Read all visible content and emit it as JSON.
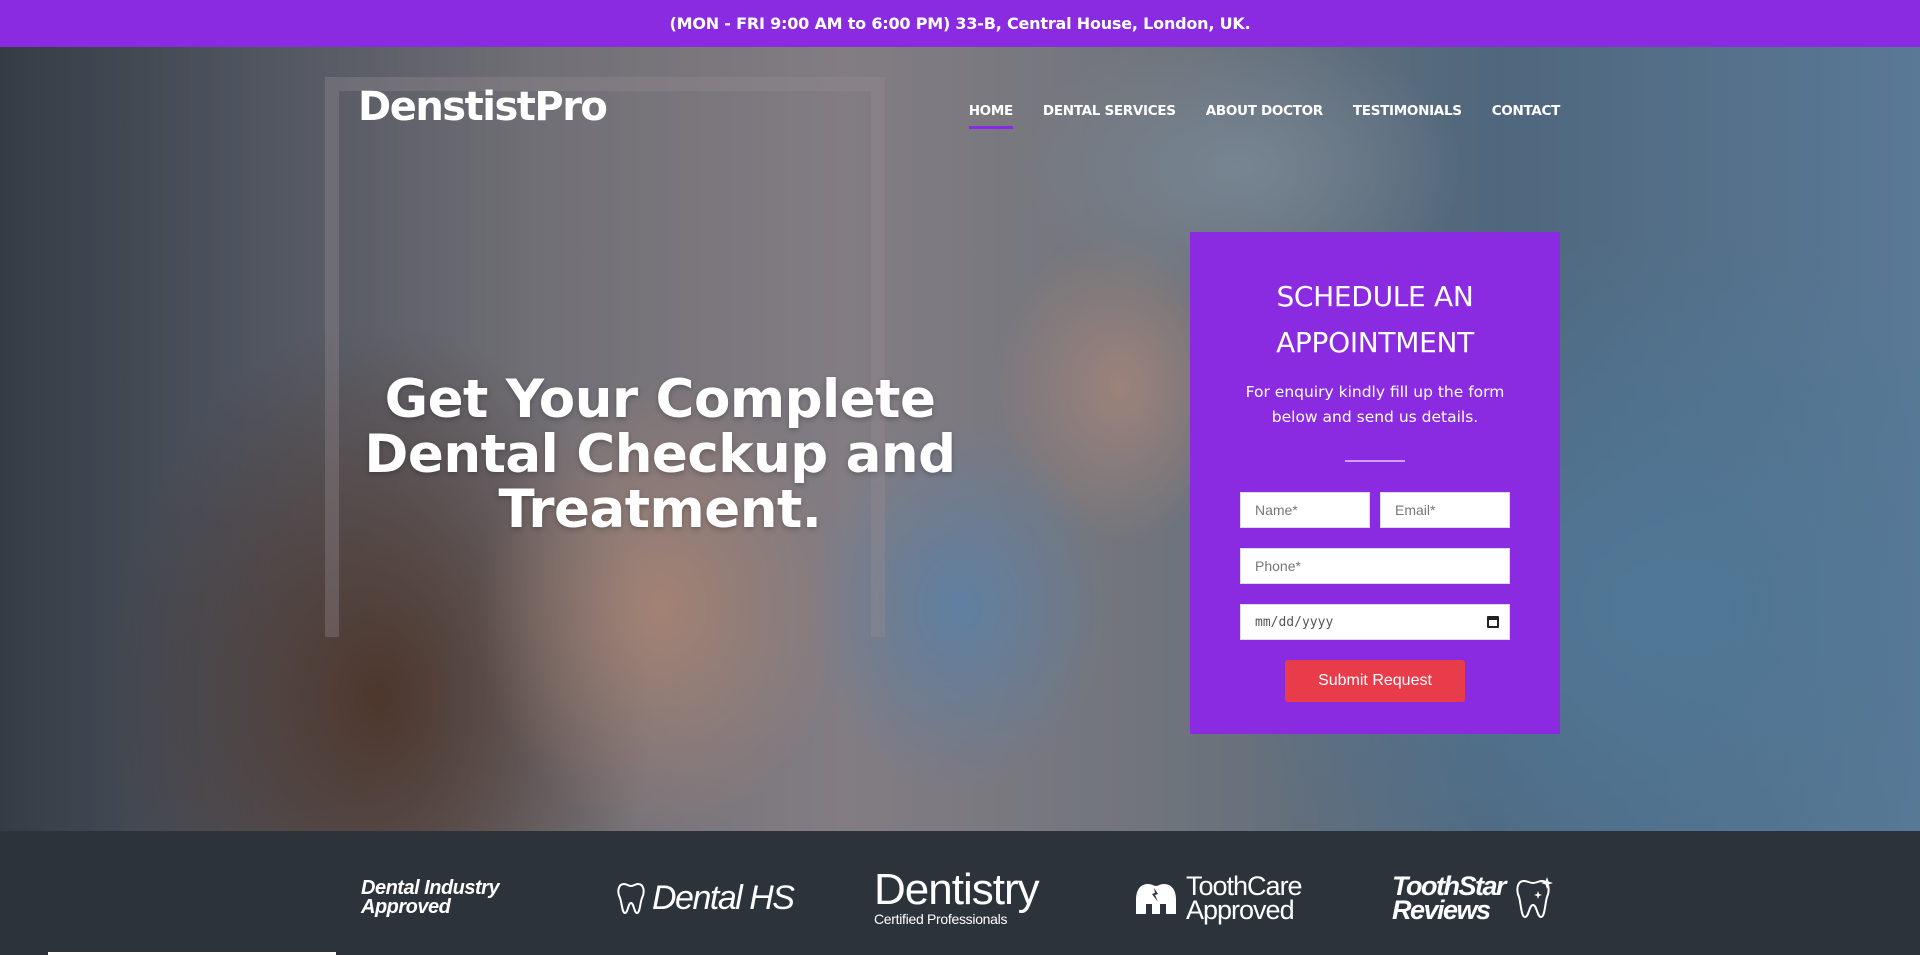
{
  "topbar": {
    "text": "(MON - FRI 9:00 AM to 6:00 PM) 33-B, Central House, London, UK."
  },
  "brand": {
    "name": "DenstistPro"
  },
  "nav": {
    "items": [
      {
        "label": "HOME",
        "active": true
      },
      {
        "label": "DENTAL SERVICES"
      },
      {
        "label": "ABOUT DOCTOR"
      },
      {
        "label": "TESTIMONIALS"
      },
      {
        "label": "CONTACT"
      }
    ]
  },
  "hero": {
    "headline": "Get Your Complete Dental Checkup and Treatment."
  },
  "appointment": {
    "title": "SCHEDULE AN APPOINTMENT",
    "subtitle": "For enquiry kindly fill up the form below and send us details.",
    "name_placeholder": "Name*",
    "email_placeholder": "Email*",
    "phone_placeholder": "Phone*",
    "date_placeholder": "mm/dd/yyyy",
    "submit_label": "Submit Request"
  },
  "partner_logos": {
    "dental_industry_line1": "Dental Industry",
    "dental_industry_line2": "Approved",
    "dental_hs": "Dental HS",
    "dentistry": "Dentistry",
    "dentistry_sub": "Certified Professionals",
    "toothcare_line1": "ToothCare",
    "toothcare_line2": "Approved",
    "toothstar_line1": "ToothStar",
    "toothstar_line2": "Reviews"
  },
  "colors": {
    "brand_purple": "#8a2be2",
    "submit_red": "#e93c4a",
    "band_dark": "#2d333b"
  }
}
